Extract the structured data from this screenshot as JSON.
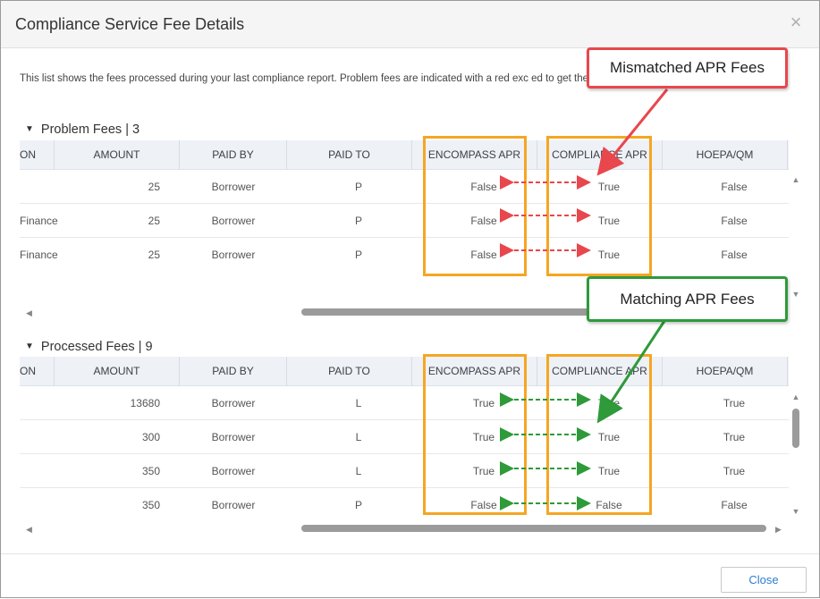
{
  "dialog": {
    "title": "Compliance Service Fee Details",
    "close_glyph": "×",
    "description": "This list shows the fees processed during your last compliance report. Problem fees are indicated with a red exc                                                                                  ed to get the most accurate Compliance report."
  },
  "columns": [
    "ON",
    "AMOUNT",
    "PAID BY",
    "PAID TO",
    "ENCOMPASS APR",
    "COMPLIANCE APR",
    "HOEPA/QM"
  ],
  "problem": {
    "title": "Problem Fees | 3",
    "rows": [
      {
        "desc": "",
        "amount": "25",
        "paid_by": "Borrower",
        "paid_to": "P",
        "encompass": "False",
        "compliance": "True",
        "hoepa": "False"
      },
      {
        "desc": "Finance",
        "amount": "25",
        "paid_by": "Borrower",
        "paid_to": "P",
        "encompass": "False",
        "compliance": "True",
        "hoepa": "False"
      },
      {
        "desc": "Finance",
        "amount": "25",
        "paid_by": "Borrower",
        "paid_to": "P",
        "encompass": "False",
        "compliance": "True",
        "hoepa": "False"
      }
    ]
  },
  "processed": {
    "title": "Processed Fees | 9",
    "rows": [
      {
        "desc": "",
        "amount": "13680",
        "paid_by": "Borrower",
        "paid_to": "L",
        "encompass": "True",
        "compliance": "True",
        "hoepa": "True"
      },
      {
        "desc": "",
        "amount": "300",
        "paid_by": "Borrower",
        "paid_to": "L",
        "encompass": "True",
        "compliance": "True",
        "hoepa": "True"
      },
      {
        "desc": "",
        "amount": "350",
        "paid_by": "Borrower",
        "paid_to": "L",
        "encompass": "True",
        "compliance": "True",
        "hoepa": "True"
      },
      {
        "desc": "",
        "amount": "350",
        "paid_by": "Borrower",
        "paid_to": "P",
        "encompass": "False",
        "compliance": "False",
        "hoepa": "False"
      }
    ]
  },
  "callouts": {
    "mismatched": "Mismatched APR Fees",
    "matching": "Matching APR Fees"
  },
  "footer": {
    "close_label": "Close"
  },
  "colors": {
    "highlight": "#f5a623",
    "mismatch": "#e8474d",
    "match": "#2e9a3a",
    "link": "#2e7dd1"
  }
}
